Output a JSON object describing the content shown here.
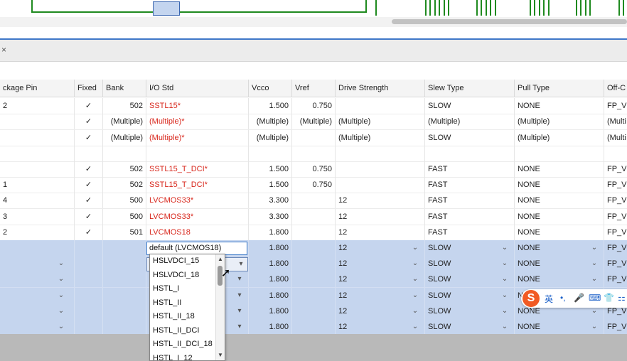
{
  "tab": {
    "close_glyph": "×"
  },
  "table": {
    "columns": [
      "ckage Pin",
      "Fixed",
      "Bank",
      "I/O Std",
      "Vcco",
      "Vref",
      "Drive Strength",
      "Slew Type",
      "Pull Type",
      "Off-C"
    ],
    "rows": [
      {
        "pin": "2",
        "fixed": "✓",
        "bank": "502",
        "iostd": "SSTL15*",
        "vcco": "1.500",
        "vref": "0.750",
        "drive": "",
        "slew": "SLOW",
        "pull": "NONE",
        "offc": "FP_V"
      },
      {
        "pin": "",
        "fixed": "✓",
        "bank": "(Multiple)",
        "iostd": "(Multiple)*",
        "vcco": "(Multiple)",
        "vref": "(Multiple)",
        "drive": "(Multiple)",
        "slew": "(Multiple)",
        "pull": "(Multiple)",
        "offc": "(Multi"
      },
      {
        "pin": "",
        "fixed": "✓",
        "bank": "(Multiple)",
        "iostd": "(Multiple)*",
        "vcco": "(Multiple)",
        "vref": "",
        "drive": "(Multiple)",
        "slew": "SLOW",
        "pull": "(Multiple)",
        "offc": "(Multi"
      },
      {
        "pin": "",
        "fixed": "",
        "bank": "",
        "iostd": "",
        "vcco": "",
        "vref": "",
        "drive": "",
        "slew": "",
        "pull": "",
        "offc": ""
      },
      {
        "pin": "",
        "fixed": "✓",
        "bank": "502",
        "iostd": "SSTL15_T_DCI*",
        "vcco": "1.500",
        "vref": "0.750",
        "drive": "",
        "slew": "FAST",
        "pull": "NONE",
        "offc": "FP_V"
      },
      {
        "pin": "1",
        "fixed": "✓",
        "bank": "502",
        "iostd": "SSTL15_T_DCI*",
        "vcco": "1.500",
        "vref": "0.750",
        "drive": "",
        "slew": "FAST",
        "pull": "NONE",
        "offc": "FP_V"
      },
      {
        "pin": "4",
        "fixed": "✓",
        "bank": "500",
        "iostd": "LVCMOS33*",
        "vcco": "3.300",
        "vref": "",
        "drive": "12",
        "slew": "FAST",
        "pull": "NONE",
        "offc": "FP_V"
      },
      {
        "pin": "3",
        "fixed": "✓",
        "bank": "500",
        "iostd": "LVCMOS33*",
        "vcco": "3.300",
        "vref": "",
        "drive": "12",
        "slew": "FAST",
        "pull": "NONE",
        "offc": "FP_V"
      },
      {
        "pin": "2",
        "fixed": "✓",
        "bank": "501",
        "iostd": "LVCMOS18",
        "vcco": "1.800",
        "vref": "",
        "drive": "12",
        "slew": "FAST",
        "pull": "NONE",
        "offc": "FP_V"
      },
      {
        "pin": "",
        "fixed": "",
        "bank": "",
        "iostd": "",
        "vcco": "1.800",
        "vref": "",
        "drive": "12",
        "slew": "SLOW",
        "pull": "NONE",
        "offc": "FP_V"
      },
      {
        "pin": "",
        "fixed": "",
        "bank": "",
        "iostd": "",
        "vcco": "1.800",
        "vref": "",
        "drive": "12",
        "slew": "SLOW",
        "pull": "NONE",
        "offc": "FP_V"
      },
      {
        "pin": "",
        "fixed": "",
        "bank": "",
        "iostd": "",
        "vcco": "1.800",
        "vref": "",
        "drive": "12",
        "slew": "SLOW",
        "pull": "NONE",
        "offc": "FP_V"
      },
      {
        "pin": "",
        "fixed": "",
        "bank": "",
        "iostd": "",
        "vcco": "1.800",
        "vref": "",
        "drive": "12",
        "slew": "SLOW",
        "pull": "N",
        "offc": "FP_V"
      },
      {
        "pin": "",
        "fixed": "",
        "bank": "",
        "iostd": "",
        "vcco": "1.800",
        "vref": "",
        "drive": "12",
        "slew": "SLOW",
        "pull": "NONE",
        "offc": "FP_V"
      },
      {
        "pin": "",
        "fixed": "",
        "bank": "",
        "iostd": "",
        "vcco": "1.800",
        "vref": "",
        "drive": "12",
        "slew": "SLOW",
        "pull": "NONE",
        "offc": "FP_V"
      }
    ]
  },
  "editor": {
    "value": "default (LVCMOS18)",
    "options": [
      "HSLVDCI_15",
      "HSLVDCI_18",
      "HSTL_I",
      "HSTL_II",
      "HSTL_II_18",
      "HSTL_II_DCI",
      "HSTL_II_DCI_18",
      "HSTL_I_12"
    ]
  },
  "ime": {
    "logo": "S",
    "mode": "英",
    "icons": [
      "•,",
      "🎤",
      "⌨",
      "👕",
      "⚏"
    ]
  },
  "colors": {
    "accent": "#3f77c8",
    "selection": "#c5d5ee",
    "error_text": "#d8261b",
    "schematic": "#1f8a1f"
  }
}
